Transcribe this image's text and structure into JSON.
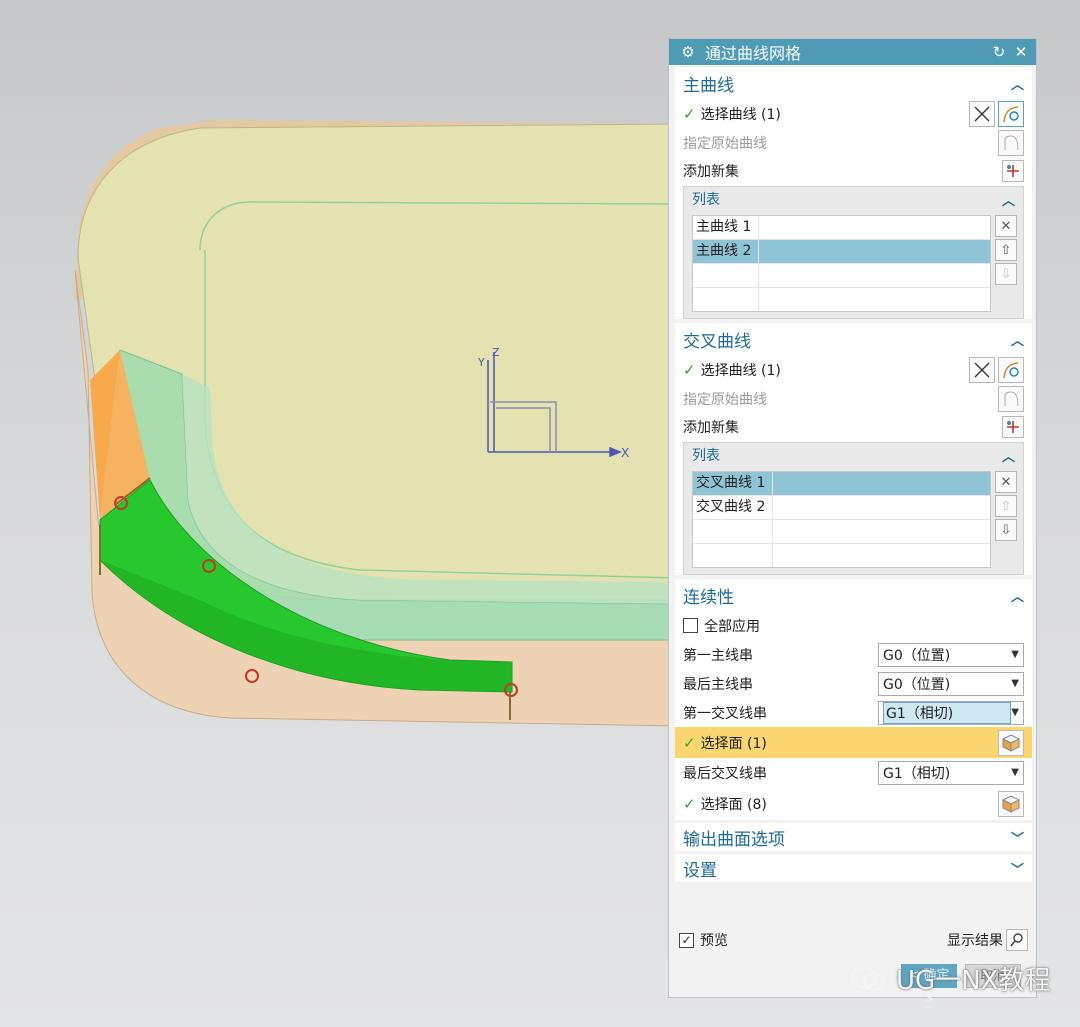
{
  "window": {
    "title": "通过曲线网格"
  },
  "primary": {
    "header": "主曲线",
    "select_curve": "选择曲线 (1)",
    "specify_origin": "指定原始曲线",
    "add_new_set": "添加新集",
    "list_header": "列表",
    "items": [
      "主曲线 1",
      "主曲线 2"
    ],
    "selected_index": 1
  },
  "cross": {
    "header": "交叉曲线",
    "select_curve": "选择曲线 (1)",
    "specify_origin": "指定原始曲线",
    "add_new_set": "添加新集",
    "list_header": "列表",
    "items": [
      "交叉曲线 1",
      "交叉曲线 2"
    ],
    "selected_index": 0
  },
  "continuity": {
    "header": "连续性",
    "apply_all": "全部应用",
    "apply_all_checked": false,
    "first_primary_label": "第一主线串",
    "first_primary_value": "G0（位置)",
    "last_primary_label": "最后主线串",
    "last_primary_value": "G0（位置)",
    "first_cross_label": "第一交叉线串",
    "first_cross_value": "G1（相切)",
    "select_face_1": "选择面 (1)",
    "last_cross_label": "最后交叉线串",
    "last_cross_value": "G1（相切)",
    "select_face_2": "选择面 (8)"
  },
  "output_options": {
    "header": "输出曲面选项"
  },
  "settings": {
    "header": "设置"
  },
  "footer": {
    "preview_label": "预览",
    "preview_checked": true,
    "show_result": "显示结果",
    "ok_label": "< 确定 >",
    "cancel_label": "取消"
  },
  "viewport": {
    "axes": {
      "x": "X",
      "y": "Y",
      "z": "Z"
    }
  },
  "watermark": {
    "text": "UG一NX教程"
  },
  "colors": {
    "title_bar": "#4f9bb6",
    "group_header_text": "#1d6b98",
    "highlight_row": "#fbd670",
    "selected_list_row": "#8fc3d6",
    "surface_green": "#22c42a",
    "top_face": "#e3e2b0",
    "side_face": "#e8c9a6"
  }
}
